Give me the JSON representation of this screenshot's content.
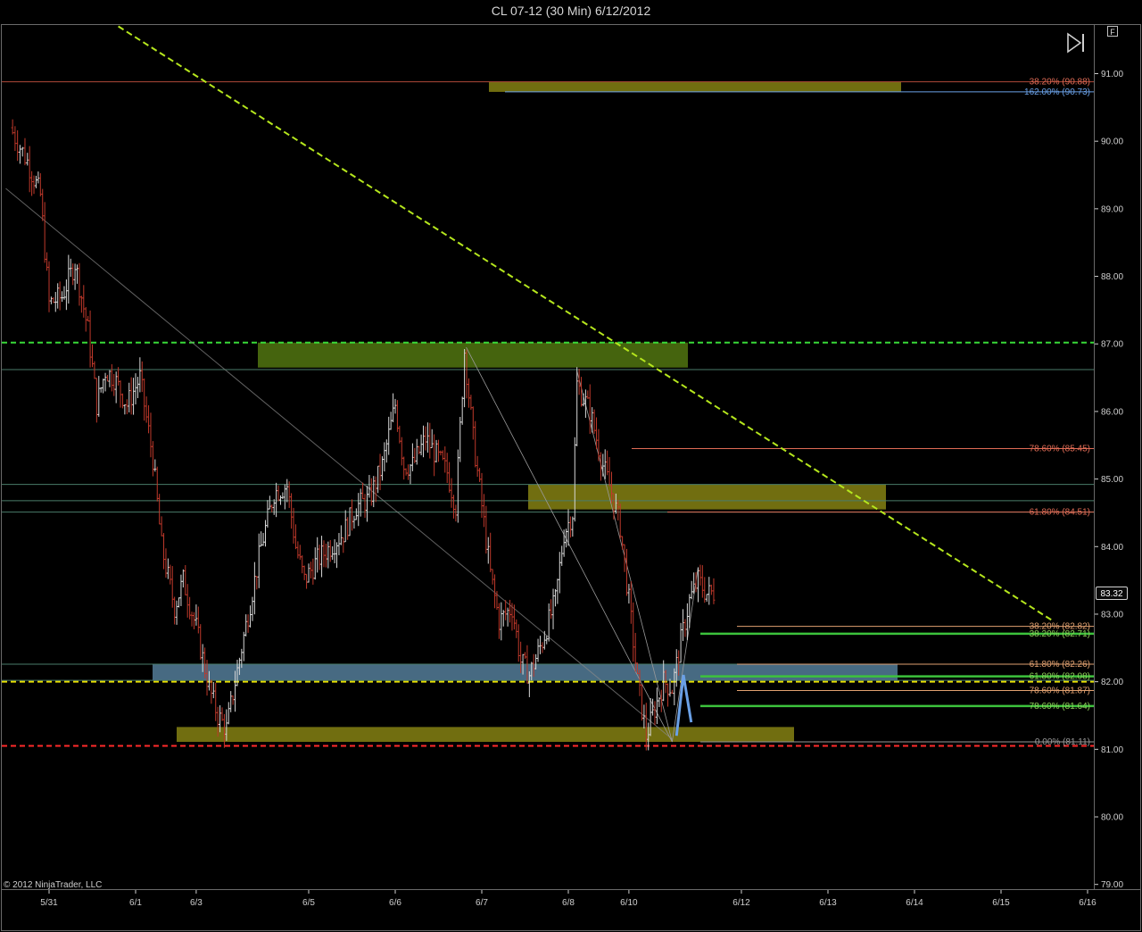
{
  "window": {
    "title": "CL 07-12 (30 Min)  6/12/2012"
  },
  "footer": {
    "copyright": "© 2012 NinjaTrader, LLC"
  },
  "controls": {
    "f_label": "F",
    "play_icon": "skip-forward-icon"
  },
  "price_marker": {
    "label": "83.32",
    "value": 83.32
  },
  "colors": {
    "background": "#000000",
    "up_bar": "#d8d8d8",
    "down_bar": "#c0392b",
    "green_dashed": "#38d938",
    "lime_dashed": "#b5e61d",
    "red_dashed": "#ff2a2a",
    "yellow_dashed": "#e8e000",
    "olive_zone": "#7d7a12",
    "green_zone": "#4c6f10",
    "blue_zone": "#4f7590",
    "fib_red_text": "#e06b55",
    "fib_blue_text": "#6aa0e6",
    "fib_green_text": "#8fcf5a",
    "fib_gray_text": "#9a9a9a"
  },
  "chart_data": {
    "type": "ohlc",
    "instrument": "CL 07-12",
    "interval": "30 Min",
    "ylim": [
      78.93,
      91.72
    ],
    "y_ticks": [
      "79.00",
      "80.00",
      "81.00",
      "82.00",
      "83.00",
      "84.00",
      "85.00",
      "86.00",
      "87.00",
      "88.00",
      "89.00",
      "90.00",
      "91.00"
    ],
    "x_ticks": [
      {
        "label": "5/31",
        "day": 0
      },
      {
        "label": "6/1",
        "day": 1
      },
      {
        "label": "6/3",
        "day": 1.7
      },
      {
        "label": "6/5",
        "day": 3
      },
      {
        "label": "6/6",
        "day": 4
      },
      {
        "label": "6/7",
        "day": 5
      },
      {
        "label": "6/8",
        "day": 6
      },
      {
        "label": "6/10",
        "day": 6.7
      },
      {
        "label": "6/12",
        "day": 8
      },
      {
        "label": "6/13",
        "day": 9
      },
      {
        "label": "6/14",
        "day": 10
      },
      {
        "label": "6/15",
        "day": 11
      },
      {
        "label": "6/16",
        "day": 12
      }
    ],
    "price_path": [
      [
        -0.45,
        90.2
      ],
      [
        -0.25,
        89.7
      ],
      [
        -0.1,
        89.2
      ],
      [
        0.0,
        87.6
      ],
      [
        0.15,
        87.7
      ],
      [
        0.3,
        88.2
      ],
      [
        0.45,
        87.2
      ],
      [
        0.55,
        86.1
      ],
      [
        0.65,
        86.6
      ],
      [
        0.75,
        86.5
      ],
      [
        0.9,
        86.1
      ],
      [
        1.05,
        86.5
      ],
      [
        1.2,
        85.3
      ],
      [
        1.3,
        84.0
      ],
      [
        1.45,
        83.1
      ],
      [
        1.55,
        83.5
      ],
      [
        1.7,
        82.8
      ],
      [
        1.85,
        81.9
      ],
      [
        1.95,
        81.5
      ],
      [
        2.05,
        81.3
      ],
      [
        2.15,
        82.0
      ],
      [
        2.3,
        83.0
      ],
      [
        2.45,
        84.0
      ],
      [
        2.6,
        84.8
      ],
      [
        2.75,
        84.9
      ],
      [
        2.85,
        84.0
      ],
      [
        2.95,
        83.5
      ],
      [
        3.1,
        83.8
      ],
      [
        3.25,
        84.0
      ],
      [
        3.4,
        84.2
      ],
      [
        3.55,
        84.6
      ],
      [
        3.7,
        84.7
      ],
      [
        3.85,
        85.2
      ],
      [
        4.0,
        86.1
      ],
      [
        4.1,
        85.2
      ],
      [
        4.2,
        85.2
      ],
      [
        4.35,
        85.6
      ],
      [
        4.5,
        85.3
      ],
      [
        4.6,
        85.1
      ],
      [
        4.7,
        84.6
      ],
      [
        4.8,
        86.9
      ],
      [
        4.9,
        85.6
      ],
      [
        5.0,
        84.6
      ],
      [
        5.1,
        83.6
      ],
      [
        5.2,
        82.9
      ],
      [
        5.35,
        83.1
      ],
      [
        5.45,
        82.3
      ],
      [
        5.55,
        82.1
      ],
      [
        5.7,
        82.6
      ],
      [
        5.85,
        83.2
      ],
      [
        5.95,
        84.2
      ],
      [
        6.05,
        84.5
      ],
      [
        6.1,
        86.4
      ],
      [
        6.25,
        86.0
      ],
      [
        6.4,
        85.2
      ],
      [
        6.5,
        84.8
      ],
      [
        6.6,
        84.3
      ],
      [
        6.7,
        83.2
      ],
      [
        6.8,
        82.0
      ],
      [
        6.9,
        81.2
      ],
      [
        7.0,
        81.6
      ],
      [
        7.1,
        82.0
      ],
      [
        7.2,
        81.9
      ],
      [
        7.3,
        82.6
      ],
      [
        7.4,
        83.2
      ],
      [
        7.5,
        83.5
      ],
      [
        7.6,
        83.3
      ],
      [
        7.68,
        83.32
      ]
    ],
    "fib_labels": [
      {
        "text": "38.20% (90.88)",
        "price": 90.88,
        "color": "#e06b55"
      },
      {
        "text": "162.00% (90.73)",
        "price": 90.73,
        "color": "#6aa0e6"
      },
      {
        "text": "78.60% (85.45)",
        "price": 85.45,
        "color": "#e06b55"
      },
      {
        "text": "61.80% (84.51)",
        "price": 84.51,
        "color": "#e06b55"
      },
      {
        "text": "38.20% (82.82)",
        "price": 82.82,
        "color": "#e0a070"
      },
      {
        "text": "38.20% (82.71)",
        "price": 82.71,
        "color": "#8fcf5a"
      },
      {
        "text": "61.80% (82.26)",
        "price": 82.26,
        "color": "#e0a070"
      },
      {
        "text": "61.80% (82.08)",
        "price": 82.08,
        "color": "#8fcf5a"
      },
      {
        "text": "78.60% (81.87)",
        "price": 81.87,
        "color": "#e0a070"
      },
      {
        "text": "78.60% (81.64)",
        "price": 81.64,
        "color": "#8fcf5a"
      },
      {
        "text": "0.00% (81.11)",
        "price": 81.11,
        "color": "#9a9a9a"
      }
    ],
    "zones": [
      {
        "name": "top-olive",
        "price_top": 90.88,
        "price_bottom": 90.73,
        "color": "#7d7a12"
      },
      {
        "name": "green-resistance",
        "price_top": 87.02,
        "price_bottom": 86.65,
        "color": "#4c6f10"
      },
      {
        "name": "olive-mid",
        "price_top": 84.92,
        "price_bottom": 84.55,
        "color": "#7d7a12"
      },
      {
        "name": "blue-support",
        "price_top": 82.26,
        "price_bottom": 82.02,
        "color": "#4f7590"
      },
      {
        "name": "olive-bottom",
        "price_top": 81.33,
        "price_bottom": 81.11,
        "color": "#7d7a12"
      }
    ],
    "horizontal_lines": [
      {
        "name": "green-dashed-87",
        "price": 87.02,
        "style": "dashed",
        "color": "#38d938"
      },
      {
        "name": "red-dashed-81",
        "price": 81.05,
        "style": "dashed",
        "color": "#ff2a2a"
      },
      {
        "name": "yellow-dashed-82",
        "price": 82.0,
        "style": "dashed",
        "color": "#e8e000"
      }
    ],
    "trendlines": [
      {
        "name": "lime-downtrend",
        "style": "dashed",
        "color": "#b5e61d",
        "from": [
          0.8,
          91.7
        ],
        "to": [
          11.6,
          82.9
        ]
      },
      {
        "name": "gray-downtrend",
        "style": "solid",
        "color": "#8a8a8a",
        "from": [
          -0.5,
          89.3
        ],
        "to": [
          7.2,
          81.15
        ]
      }
    ]
  }
}
